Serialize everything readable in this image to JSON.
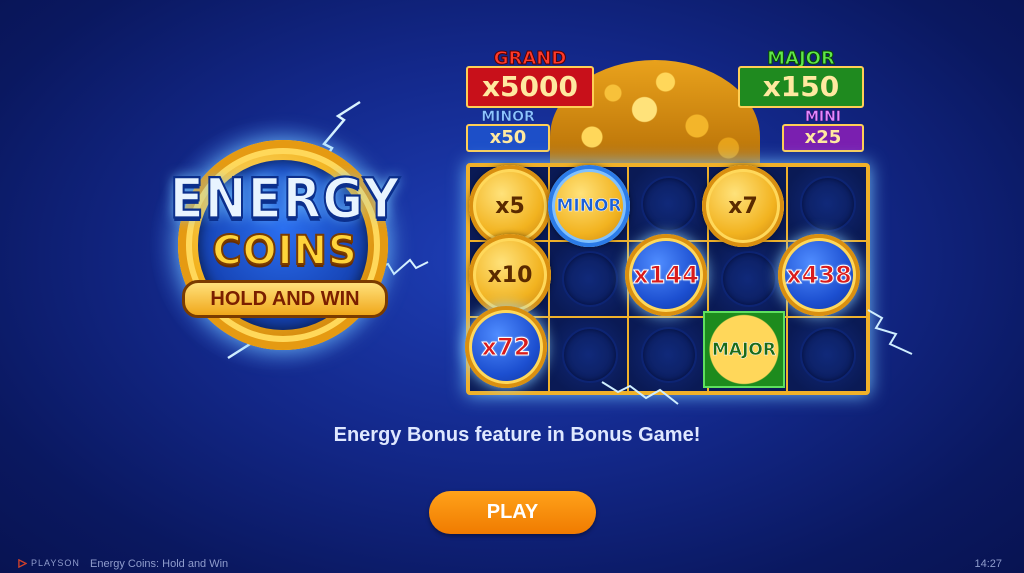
{
  "logo": {
    "line1": "ENERGY",
    "line2": "COINS",
    "ribbon": "HOLD AND WIN"
  },
  "jackpots": {
    "grand": {
      "label": "GRAND",
      "value": "x5000",
      "color": "#c8101a"
    },
    "major": {
      "label": "MAJOR",
      "value": "x150",
      "color": "#1f8a1f"
    },
    "minor": {
      "label": "MINOR",
      "value": "x50",
      "color": "#1d4fc8"
    },
    "mini": {
      "label": "MINI",
      "value": "x25",
      "color": "#7a1fb0"
    }
  },
  "grid": {
    "coins": [
      {
        "text": "x5",
        "style": "gold"
      },
      {
        "text": "MINOR",
        "style": "minor"
      },
      {
        "text": "x7",
        "style": "gold"
      },
      {
        "text": "x10",
        "style": "gold"
      },
      {
        "text": "x144",
        "style": "blue"
      },
      {
        "text": "x438",
        "style": "blue"
      },
      {
        "text": "x72",
        "style": "blue"
      },
      {
        "text": "MAJOR",
        "style": "major"
      }
    ]
  },
  "caption": "Energy Bonus feature in Bonus Game!",
  "play_button": "PLAY",
  "footer": {
    "brand": "PLAYSON",
    "game_name": "Energy Coins: Hold and Win",
    "clock": "14:27"
  },
  "colors": {
    "background": "#13288a",
    "play_button": "#f58a0a",
    "gold": "#f2b320"
  }
}
